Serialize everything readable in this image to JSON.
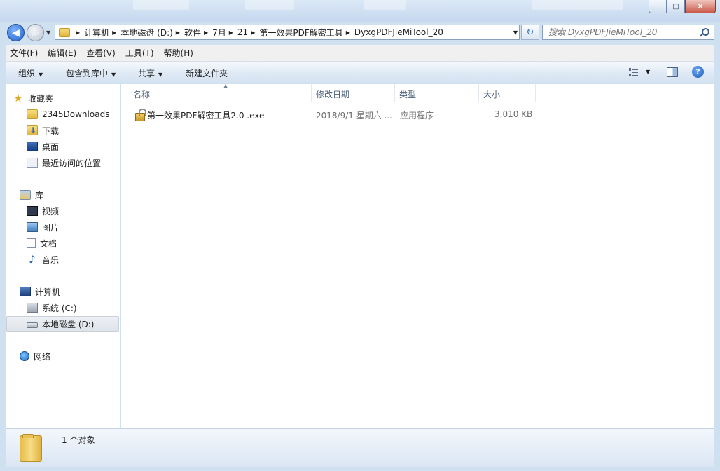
{
  "window": {
    "minimize_glyph": "─",
    "maximize_glyph": "□",
    "close_glyph": "✕"
  },
  "nav": {
    "back_glyph": "◀",
    "forward_glyph": "▶",
    "breadcrumbs": [
      "计算机",
      "本地磁盘 (D:)",
      "软件",
      "7月",
      "21",
      "第一效果PDF解密工具",
      "DyxgPDFJieMiTool_20"
    ],
    "refresh_glyph": "↻",
    "search_placeholder": "搜索 DyxgPDFJieMiTool_20"
  },
  "menubar": [
    "文件(F)",
    "编辑(E)",
    "查看(V)",
    "工具(T)",
    "帮助(H)"
  ],
  "commands": {
    "organize": "组织",
    "include_in_library": "包含到库中",
    "share": "共享",
    "new_folder": "新建文件夹",
    "help_glyph": "?"
  },
  "sidebar": {
    "favorites": {
      "label": "收藏夹",
      "items": [
        "2345Downloads",
        "下载",
        "桌面",
        "最近访问的位置"
      ]
    },
    "libraries": {
      "label": "库",
      "items": [
        "视频",
        "图片",
        "文档",
        "音乐"
      ]
    },
    "computer": {
      "label": "计算机",
      "items": [
        "系统 (C:)",
        "本地磁盘 (D:)"
      ]
    },
    "network": {
      "label": "网络"
    }
  },
  "columns": [
    "名称",
    "修改日期",
    "类型",
    "大小"
  ],
  "files": [
    {
      "name": "第一效果PDF解密工具2.0 .exe",
      "modified": "2018/9/1 星期六 ...",
      "type": "应用程序",
      "size": "3,010 KB"
    }
  ],
  "status": {
    "item_count": "1 个对象"
  }
}
